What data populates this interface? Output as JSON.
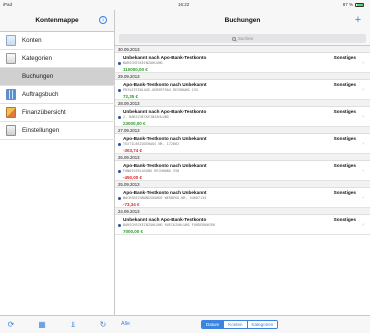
{
  "statusbar": {
    "device": "iPad",
    "time": "16:22",
    "battery": "87 %"
  },
  "sidebar": {
    "title": "Kontenmappe",
    "items": [
      {
        "label": "Konten",
        "icon": "folder-icon",
        "active": false
      },
      {
        "label": "Kategorien",
        "icon": "categories-icon",
        "active": false
      },
      {
        "label": "Buchungen",
        "icon": "",
        "active": true
      },
      {
        "label": "Auftragsbuch",
        "icon": "orderbook-icon",
        "active": false
      },
      {
        "label": "Finanzübersicht",
        "icon": "finance-overview-icon",
        "active": false
      },
      {
        "label": "Einstellungen",
        "icon": "settings-icon",
        "active": false
      }
    ],
    "footer_icons": [
      "sync-icon",
      "grid-icon",
      "filter-icon",
      "refresh-icon"
    ]
  },
  "main": {
    "title": "Buchungen",
    "add_label": "+",
    "search_placeholder": "Suchen",
    "groups": [
      {
        "date": "30.09.2013",
        "title": "Unbekannt nach Apo-Bank-Testkonto",
        "category": "Sonstiges",
        "detail": "BARSCHECKEINZAHLUNG",
        "amount": "110000,00 €",
        "sign": "pos"
      },
      {
        "date": "29.09.2013",
        "title": "Apo-Bank-Testkonto nach Unbekannt",
        "category": "Sonstiges",
        "detail": "PRIVATEINLAGE-UEBERTRAG RECHNUNG 155",
        "amount": "72,35 €",
        "sign": "pos"
      },
      {
        "date": "28.09.2013",
        "title": "Unbekannt nach Apo-Bank-Testkonto",
        "category": "Sonstiges",
        "detail": "2. BARSCHECKEINZAHLUNG",
        "amount": "23000,00 €",
        "sign": "pos"
      },
      {
        "date": "27.09.2013",
        "title": "Apo-Bank-Testkonto nach Unbekannt",
        "category": "Sonstiges",
        "detail": "TEXTILBEZUGSHAUS NR. 172662",
        "amount": "-303,74 €",
        "sign": "neg"
      },
      {
        "date": "26.09.2013",
        "title": "Apo-Bank-Testkonto nach Unbekannt",
        "category": "Sonstiges",
        "detail": "FONDSVERLOSUNG RECHNUNG 558",
        "amount": "-450,00 €",
        "sign": "neg"
      },
      {
        "date": "25.09.2013",
        "title": "Apo-Bank-Testkonto nach Unbekannt",
        "category": "Sonstiges",
        "detail": "WACHSRECHNUNGSKUNDE WERBEKO-NR. 54667134",
        "amount": "-73,34 €",
        "sign": "neg"
      },
      {
        "date": "24.09.2013",
        "title": "Unbekannt nach Apo-Bank-Testkonto",
        "category": "Sonstiges",
        "detail": "BARSCHECKEINZAHLUNG RUECKZAHLUNG FORDERUNGEN",
        "amount": "7000,00 €",
        "sign": "pos"
      }
    ],
    "footer": {
      "alle": "Alle",
      "segments": [
        {
          "label": "Datum",
          "active": true
        },
        {
          "label": "Konten",
          "active": false
        },
        {
          "label": "Kategorien",
          "active": false
        }
      ]
    }
  },
  "colors": {
    "accent": "#3b84e0",
    "positive": "#2e9a2e",
    "negative": "#d22a2a",
    "selection": "#d0d0d0"
  }
}
